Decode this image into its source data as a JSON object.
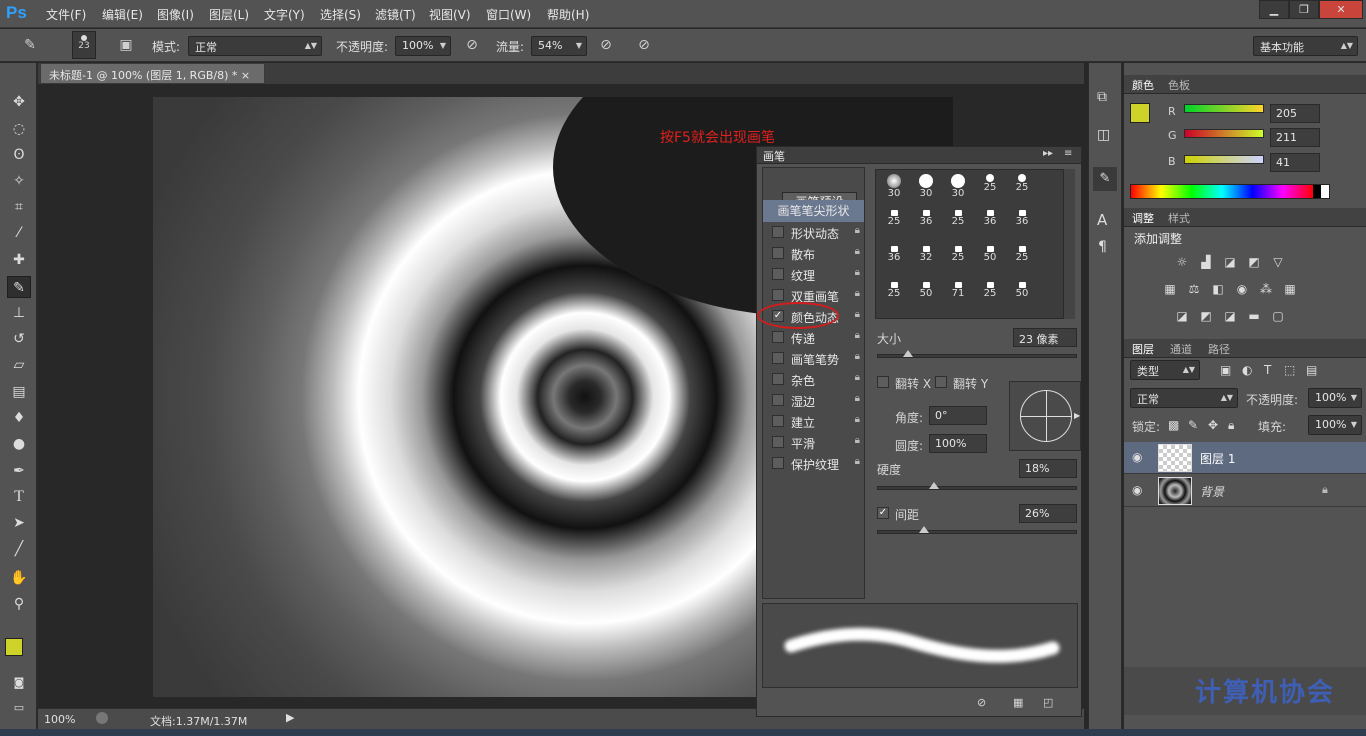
{
  "app": {
    "logo": "Ps"
  },
  "menu": [
    "文件(F)",
    "编辑(E)",
    "图像(I)",
    "图层(L)",
    "文字(Y)",
    "选择(S)",
    "滤镜(T)",
    "视图(V)",
    "窗口(W)",
    "帮助(H)"
  ],
  "window_buttons": {
    "minimize": "▁",
    "restore": "❐",
    "close": "✕"
  },
  "options": {
    "brush_size": "23",
    "mode_label": "模式:",
    "mode_value": "正常",
    "opacity_label": "不透明度:",
    "opacity_value": "100%",
    "flow_label": "流量:",
    "flow_value": "54%",
    "workspace": "基本功能"
  },
  "document": {
    "tab_title": "未标题-1 @ 100% (图层 1, RGB/8) *",
    "tab_close": "×",
    "annotation": "按F5就会出现画笔"
  },
  "status": {
    "zoom": "100%",
    "doc_info": "文档:1.37M/1.37M"
  },
  "brush_panel": {
    "title": "画笔",
    "preset_button": "画笔预设",
    "tip_shape": "画笔笔尖形状",
    "options": [
      {
        "label": "形状动态",
        "checked": false
      },
      {
        "label": "散布",
        "checked": false
      },
      {
        "label": "纹理",
        "checked": false
      },
      {
        "label": "双重画笔",
        "checked": false
      },
      {
        "label": "颜色动态",
        "checked": true
      },
      {
        "label": "传递",
        "checked": false
      },
      {
        "label": "画笔笔势",
        "checked": false
      },
      {
        "label": "杂色",
        "checked": false
      },
      {
        "label": "湿边",
        "checked": false
      },
      {
        "label": "建立",
        "checked": false
      },
      {
        "label": "平滑",
        "checked": false
      },
      {
        "label": "保护纹理",
        "checked": false
      }
    ],
    "tip_sizes": [
      "30",
      "30",
      "30",
      "25",
      "25",
      "25",
      "36",
      "25",
      "36",
      "36",
      "36",
      "32",
      "25",
      "50",
      "25",
      "25",
      "50",
      "71",
      "25",
      "50"
    ],
    "size_label": "大小",
    "size_value": "23 像素",
    "flip_x": "翻转 X",
    "flip_y": "翻转 Y",
    "angle_label": "角度:",
    "angle_value": "0°",
    "roundness_label": "圆度:",
    "roundness_value": "100%",
    "hardness_label": "硬度",
    "hardness_value": "18%",
    "spacing_label": "间距",
    "spacing_value": "26%",
    "spacing_checked": true,
    "size_level": 0.05,
    "hardness_level": 0.18,
    "spacing_level": 0.13
  },
  "color_panel": {
    "tabs": [
      "颜色",
      "色板"
    ],
    "r": "205",
    "g": "211",
    "b": "41",
    "foreground": "#cdd329"
  },
  "adjust_panel": {
    "tabs": [
      "调整",
      "样式"
    ],
    "title": "添加调整"
  },
  "layers_panel": {
    "tabs": [
      "图层",
      "通道",
      "路径"
    ],
    "filter": "类型",
    "blend": "正常",
    "opacity_label": "不透明度:",
    "opacity_value": "100%",
    "lock_label": "锁定:",
    "fill_label": "填充:",
    "fill_value": "100%",
    "layers": [
      {
        "name": "图层 1",
        "selected": true
      },
      {
        "name": "背景",
        "selected": false
      }
    ]
  },
  "watermark": "计算机协会"
}
